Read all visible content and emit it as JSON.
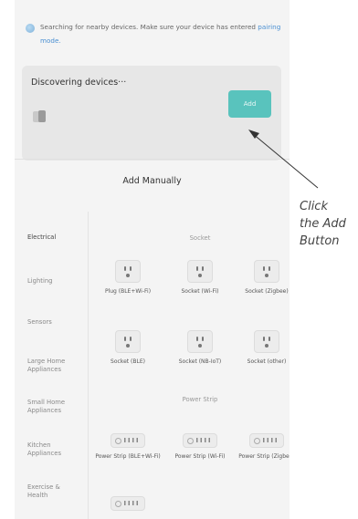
{
  "notice": {
    "text": "Searching for nearby devices. Make sure your device has entered ",
    "link": "pairing mode."
  },
  "discovery": {
    "title": "Discovering devices···",
    "add_label": "Add"
  },
  "manual": {
    "title": "Add Manually",
    "categories": [
      "Electrical",
      "Lighting",
      "Sensors",
      "Large Home Appliances",
      "Small Home Appliances",
      "Kitchen Appliances",
      "Exercise & Health"
    ],
    "groups": {
      "socket": "Socket",
      "power_strip": "Power Strip"
    },
    "devices": {
      "plug_ble_wifi": "Plug (BLE+Wi-Fi)",
      "socket_wifi": "Socket (Wi-Fi)",
      "socket_zigbee": "Socket (Zigbee)",
      "socket_ble": "Socket (BLE)",
      "socket_nb_iot": "Socket (NB-IoT)",
      "socket_other": "Socket (other)",
      "strip_ble_wifi": "Power Strip (BLE+Wi-Fi)",
      "strip_wifi": "Power Strip (Wi-Fi)",
      "strip_zigbee": "Power Strip (Zigbee)"
    }
  },
  "callout": {
    "line1": "Click",
    "line2": "the Add",
    "line3": "Button"
  },
  "colors": {
    "accent": "#59c3bd",
    "link": "#4a8fd2",
    "card_bg": "#e7e7e7",
    "screen_bg": "#f4f4f4"
  }
}
